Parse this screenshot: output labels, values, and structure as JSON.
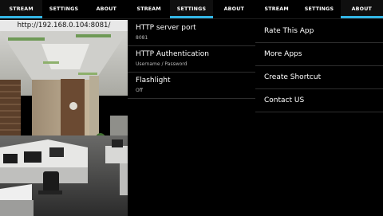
{
  "screens": [
    {
      "tabs": [
        {
          "label": "STREAM",
          "active": true
        },
        {
          "label": "SETTINGS",
          "active": false
        },
        {
          "label": "ABOUT",
          "active": false
        }
      ],
      "stream_url": "http://192.168.0.104:8081/"
    },
    {
      "tabs": [
        {
          "label": "STREAM",
          "active": false
        },
        {
          "label": "SETTINGS",
          "active": true
        },
        {
          "label": "ABOUT",
          "active": false
        }
      ],
      "settings": [
        {
          "title": "HTTP server port",
          "summary": "8081"
        },
        {
          "title": "HTTP Authentication",
          "summary": "Username / Password"
        },
        {
          "title": "Flashlight",
          "summary": "Off"
        }
      ]
    },
    {
      "tabs": [
        {
          "label": "STREAM",
          "active": false
        },
        {
          "label": "SETTINGS",
          "active": false
        },
        {
          "label": "ABOUT",
          "active": true
        }
      ],
      "about_items": [
        "Rate This App",
        "More Apps",
        "Create Shortcut",
        "Contact US"
      ]
    }
  ],
  "colors": {
    "accent": "#33b5e5",
    "background": "#000000",
    "divider": "#2e2e2e"
  }
}
